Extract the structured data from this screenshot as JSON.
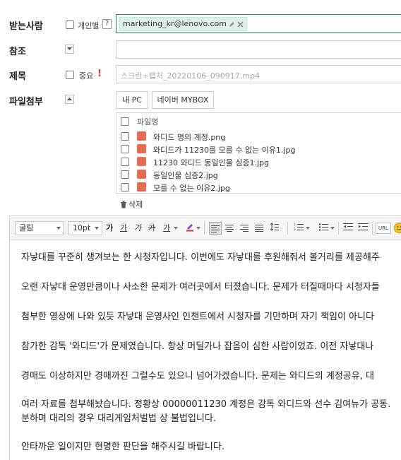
{
  "recipients": {
    "label": "받는사람",
    "personal_label": "개인별",
    "help_label": "?",
    "address": "marketing_kr@lenovo.com"
  },
  "cc": {
    "label": "참조"
  },
  "subject": {
    "label": "제목",
    "important_label": "중요",
    "important_mark": "!",
    "placeholder": "스크린+캡처_20220106_090917.mp4"
  },
  "attachments": {
    "label": "파일첨부",
    "btn_pc": "내 PC",
    "btn_mybox": "네이버 MYBOX",
    "column_header": "파일명",
    "files": [
      "와디드 명의 계정.png",
      "와디드가 11230를 모를 수 없는 이유1.jpg",
      "11230 와디드 동일인물 심증1.jpg",
      "동일인물 심증2.jpg",
      "모를 수 없는 이유2.jpg"
    ],
    "delete_label": "삭제"
  },
  "editor": {
    "font_family": "굴림",
    "font_size": "10pt",
    "bold_label": "가",
    "underline_label": "가",
    "italic_label": "가",
    "strike_label": "가",
    "color_label": "가",
    "url_label": "URL",
    "paragraphs": [
      "자낳대를 꾸준히 챙겨보는 한 시청자입니다. 이번에도 자낳대를 후원해줘서 볼거리를 제공해주",
      "오랜 자낳대 운영만큼이나 사소한 문제가 여러곳에서 터졌습니다. 문제가 터질때마다 시청자들",
      "첨부한 영상에 나와 있듯 자낳대 운영사인 인챈트에서 시청자를 기만하며 자기 책임이 아니다",
      "참가한 감독 '와디드'가 문제였습니다. 항상 머딜가나 잡음이 심한 사람이었죠. 이전 자낳대나",
      "경매도 이상하지만 경매까진 그럴수도 있으니 넘어가겠습니다. 문제는 와디드의 계정공유, 대",
      "여러 자료를 첨부해놨습니다. 정황상 00000011230 계정은 감독 와디드와 선수 김여뉴가 공동.",
      "분하며 대리의 경우 대리게임처벌법 상 불법입니다.",
      "안타까운 일이지만 현명한 판단을 해주시길 바랍니다."
    ]
  },
  "colors": {
    "active_border": "#1f8a4c",
    "tag_bg": "#dff0ea",
    "important": "#e03a2f",
    "file_icon": "#e56b54"
  }
}
